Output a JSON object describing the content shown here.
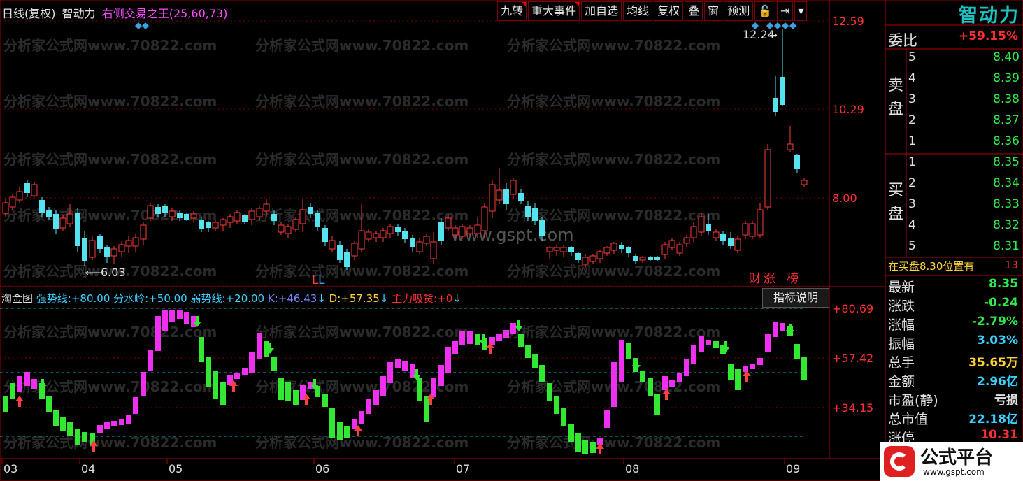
{
  "header": {
    "period": "日线(复权)",
    "stock_name": "智动力",
    "indicator": "右侧交易之王(25,60,73)"
  },
  "toolbar": [
    {
      "label": "九转",
      "flag": true
    },
    {
      "label": "重大事件",
      "flag": true
    },
    {
      "label": "加自选",
      "flag": false
    },
    {
      "label": "均线",
      "flag": false
    },
    {
      "label": "复权",
      "flag": false
    },
    {
      "label": "叠",
      "flag": false
    },
    {
      "label": "窗",
      "flag": false
    },
    {
      "label": "预测",
      "flag": false
    },
    {
      "label": "🔓",
      "icon": "lock-icon",
      "flag": false
    },
    {
      "label": "⇥",
      "icon": "expand-icon",
      "flag": false
    },
    {
      "label": "▾",
      "icon": "chevron-down-icon",
      "flag": false
    }
  ],
  "price_axis": [
    "12.59",
    "10.29",
    "8.00"
  ],
  "price_annotations": {
    "high": "12.24",
    "low": "6.03"
  },
  "badges": {
    "ll": "LL",
    "cai": "财",
    "zhang": "涨",
    "bang": "榜"
  },
  "watermark": "分析家公式网www.70822.com",
  "watermark2": "www.gspt.com",
  "indicator_panel": {
    "name": "淘金图",
    "strong_label": "强势线:",
    "strong_value": "+80.00",
    "mid_label": "分水岭:",
    "mid_value": "+50.00",
    "weak_label": "弱势线:",
    "weak_value": "+20.00",
    "k_label": "K:",
    "k_value": "+46.43",
    "d_label": "D:",
    "d_value": "+57.35",
    "main_label": "主力吸货:",
    "main_value": "+0",
    "explain_button": "指标说明",
    "axis": [
      "+80.69",
      "+57.42",
      "+34.15"
    ]
  },
  "x_axis": [
    "03",
    "04",
    "05",
    "06",
    "07",
    "08",
    "09"
  ],
  "side": {
    "brand": "智动力",
    "weibi_label": "委比",
    "weibi_value": "+59.15%",
    "sell_label": [
      "卖",
      "盘"
    ],
    "buy_label": [
      "买",
      "盘"
    ],
    "sell": [
      {
        "idx": "5",
        "price": "8.40"
      },
      {
        "idx": "4",
        "price": "8.39"
      },
      {
        "idx": "3",
        "price": "8.38"
      },
      {
        "idx": "2",
        "price": "8.37"
      },
      {
        "idx": "1",
        "price": "8.36"
      }
    ],
    "buy": [
      {
        "idx": "1",
        "price": "8.35"
      },
      {
        "idx": "2",
        "price": "8.34"
      },
      {
        "idx": "3",
        "price": "8.33"
      },
      {
        "idx": "4",
        "price": "8.32"
      },
      {
        "idx": "5",
        "price": "8.31"
      }
    ],
    "notice": "在买盘8.30位置有",
    "notice_num": "13",
    "stats": [
      {
        "k": "最新",
        "v": "8.35",
        "c": "#2fe84a"
      },
      {
        "k": "涨跌",
        "v": "-0.24",
        "c": "#2fe84a"
      },
      {
        "k": "涨幅",
        "v": "-2.79%",
        "c": "#2fe84a"
      },
      {
        "k": "振幅",
        "v": "3.03%",
        "c": "#3ad1ff"
      },
      {
        "k": "总手",
        "v": "35.65万",
        "c": "#ffd23a"
      },
      {
        "k": "金额",
        "v": "2.96亿",
        "c": "#3ad1ff"
      },
      {
        "k": "市盈(静)",
        "v": "亏损",
        "c": "#e0e0e0"
      },
      {
        "k": "总市值",
        "v": "22.18亿",
        "c": "#3ad1ff"
      },
      {
        "k": "涨停",
        "v": "10.31",
        "c": "#ff3030"
      }
    ],
    "logo_text": "公式平台",
    "logo_url": "www.gspt.com"
  },
  "colors": {
    "up": "#ff3b3b",
    "down": "#4fe0ef",
    "kline_up": "#ff3b3b",
    "kline_down": "#55e3f0",
    "bar_magenta": "#f030f0",
    "bar_green": "#33e833",
    "grid": "#7a0000",
    "dashed": "#00a8c0"
  }
}
